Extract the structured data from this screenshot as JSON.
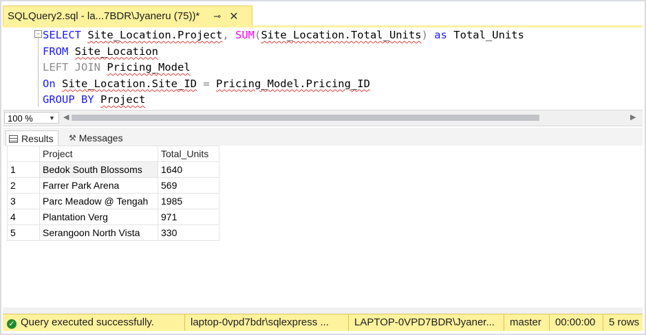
{
  "tab": {
    "title": "SQLQuery2.sql - la...7BDR\\Jyaneru (75))*",
    "pin_icon": "pin-icon",
    "close_icon": "close-icon"
  },
  "editor": {
    "collapse_glyph": "−",
    "lines": [
      {
        "t1": "SELECT",
        "t2": "Site_Location.Project",
        "t3": ", ",
        "t4": "SUM",
        "t5": "(",
        "t6": "Site_Location.Total_Units",
        "t7": ") ",
        "t8": "as",
        "t9": " Total_Units"
      },
      {
        "t1": "FROM",
        "t2": " ",
        "t3": "Site_Location"
      },
      {
        "t1": "LEFT JOIN",
        "t2": " ",
        "t3": "Pricing_Model"
      },
      {
        "t1": "On",
        "t2": " ",
        "t3": "Site_Location.Site_ID",
        "t4": " = ",
        "t5": "Pricing_Model.Pricing_ID"
      },
      {
        "t1": "GROUP BY",
        "t2": " ",
        "t3": "Project"
      }
    ]
  },
  "zoom": {
    "value": "100 %"
  },
  "result_tabs": {
    "results": "Results",
    "messages": "Messages"
  },
  "grid": {
    "columns": [
      "Project",
      "Total_Units"
    ],
    "rows": [
      {
        "num": "1",
        "project": "Bedok South Blossoms",
        "total": "1640"
      },
      {
        "num": "2",
        "project": "Farrer Park Arena",
        "total": "569"
      },
      {
        "num": "3",
        "project": "Parc Meadow @ Tengah",
        "total": "1985"
      },
      {
        "num": "4",
        "project": "Plantation Verg",
        "total": "971"
      },
      {
        "num": "5",
        "project": "Serangoon North Vista",
        "total": "330"
      }
    ]
  },
  "status": {
    "message": "Query executed successfully.",
    "server": "laptop-0vpd7bdr\\sqlexpress ...",
    "user": "LAPTOP-0VPD7BDR\\Jyaner...",
    "database": "master",
    "time": "00:00:00",
    "rows": "5 rows"
  },
  "colors": {
    "tab_accent": "#fff29d",
    "keyword": "#1a1aff",
    "function": "#ff00ff",
    "success": "#1e8c2f"
  }
}
